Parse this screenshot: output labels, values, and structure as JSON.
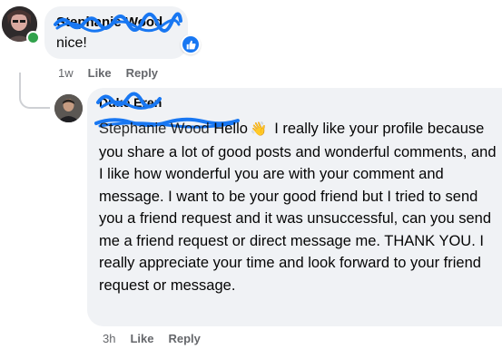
{
  "comment1": {
    "author": "Stephanie Wood",
    "text": "nice!",
    "time": "1w",
    "like_label": "Like",
    "reply_label": "Reply",
    "reaction_icon": "thumbs-up-icon"
  },
  "reply": {
    "author": "Duke Eren",
    "mention": "Stephanie Wood",
    "greeting": "Hello",
    "wave_emoji": "👋",
    "text": "I really like your profile because you share a lot of good posts and wonderful comments, and I like how wonderful you are with your comment and message. I want to be your good friend but I tried to send you a friend request and it was unsuccessful, can you send me a friend request or direct message me. THANK YOU. I really appreciate your time and look forward to your friend request or message.",
    "time": "3h",
    "like_label": "Like",
    "reply_label": "Reply"
  },
  "colors": {
    "bubble_bg": "#f0f2f5",
    "scribble": "#1877f2",
    "online": "#31a24c",
    "meta_text": "#65676b"
  }
}
